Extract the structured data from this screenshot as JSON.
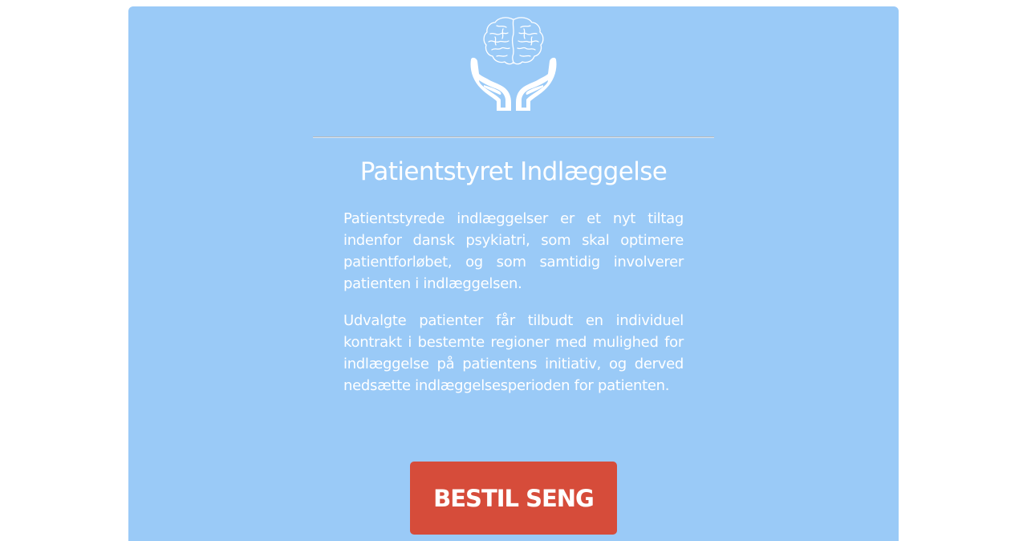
{
  "logo": {
    "icon": "brain-in-hands-icon"
  },
  "hero": {
    "title": "Patientstyret Indlæggelse",
    "paragraphs": [
      "Patientstyrede indlæggelser er et nyt tiltag indenfor dansk psykiatri, som skal optimere patientforløbet, og som samtidig involverer patienten i indlæggelsen.",
      "Udvalgte patienter får tilbudt en individuel kontrakt i bestemte regioner med mulighed for indlæggelse på patientens initiativ, og derved nedsætte indlæggelsesperioden for patienten."
    ],
    "button_label": "BESTIL SENG"
  },
  "colors": {
    "page_background": "#ffffff",
    "card_background": "#9acaf7",
    "button_background": "#d64c3a",
    "text": "#ffffff"
  }
}
